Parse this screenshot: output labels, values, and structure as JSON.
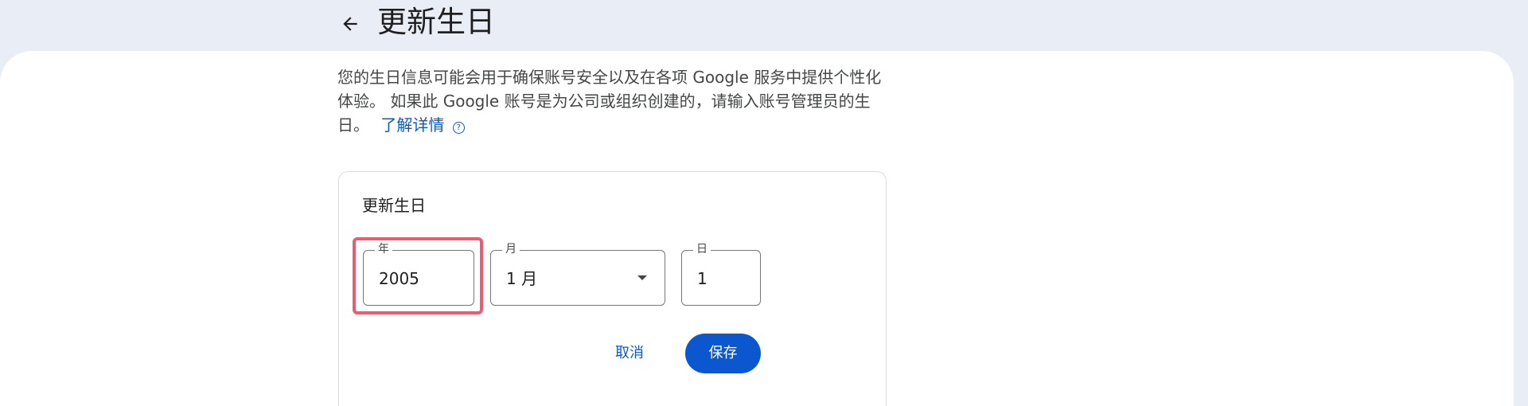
{
  "header": {
    "title": "更新生日",
    "back_icon": "arrow-left-icon"
  },
  "description": {
    "text": "您的生日信息可能会用于确保账号安全以及在各项 Google 服务中提供个性化体验。 如果此 Google 账号是为公司或组织创建的，请输入账号管理员的生日。",
    "link_label": "了解详情",
    "link_icon": "help-circle-icon"
  },
  "form": {
    "title": "更新生日",
    "year": {
      "label": "年",
      "value": "2005"
    },
    "month": {
      "label": "月",
      "value": "1 月",
      "icon": "dropdown-caret-icon"
    },
    "day": {
      "label": "日",
      "value": "1"
    },
    "cancel_label": "取消",
    "save_label": "保存"
  },
  "colors": {
    "accent": "#0b57d0",
    "header_bg": "#e9eef6",
    "highlight": "#ee5a6f"
  }
}
